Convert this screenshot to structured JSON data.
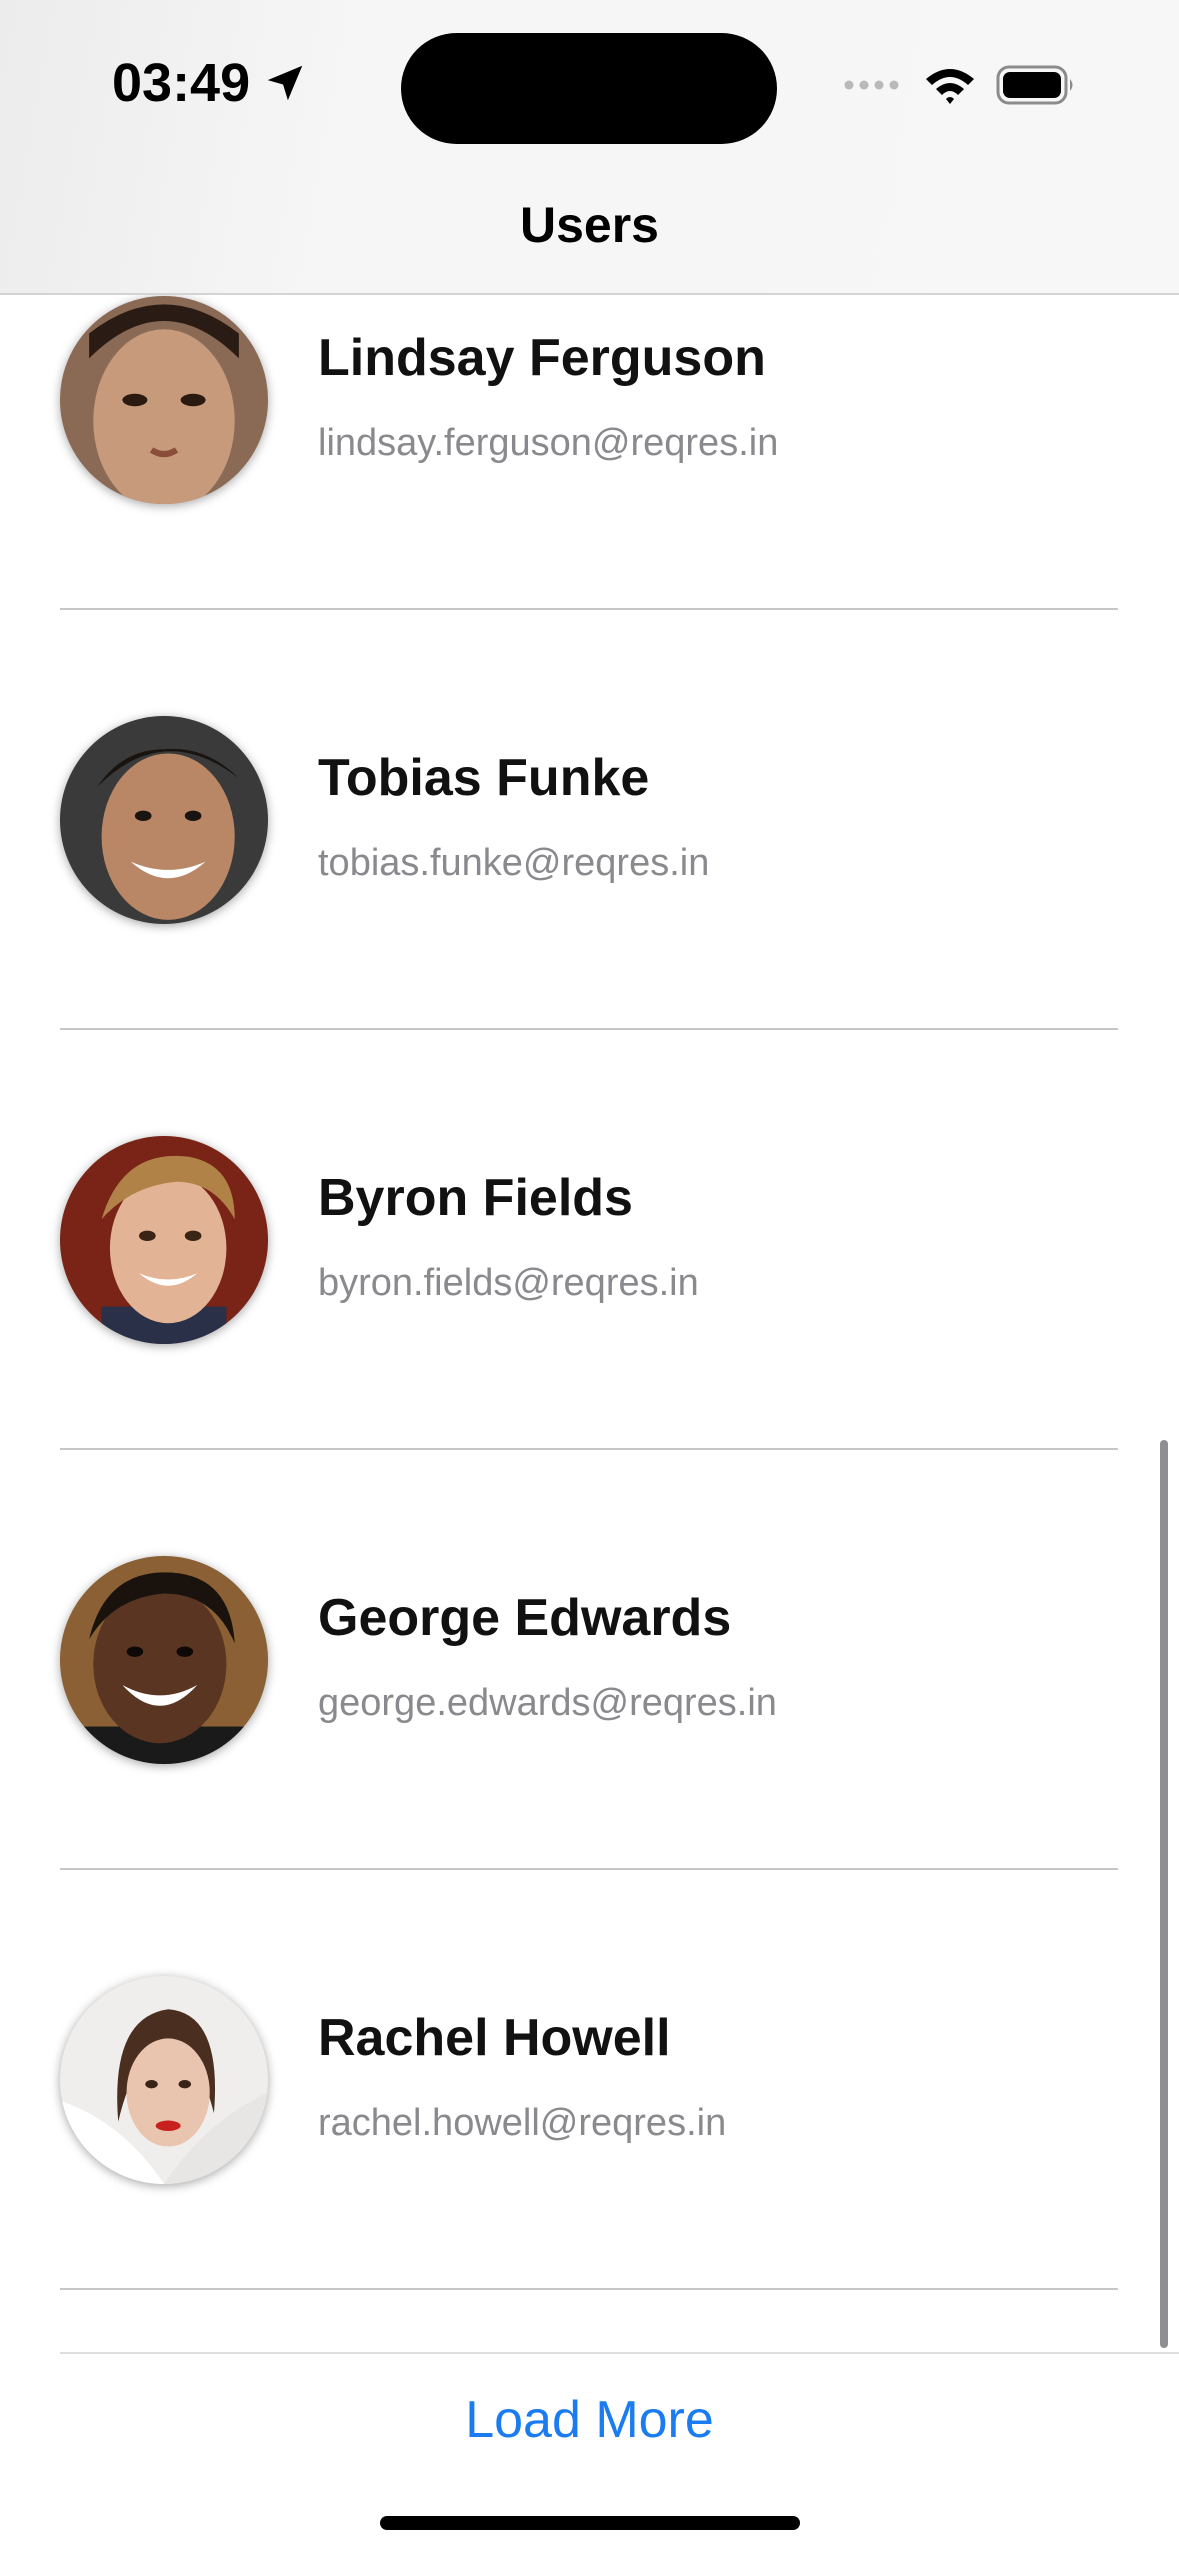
{
  "status_bar": {
    "time": "03:49",
    "icons": [
      "location-arrow-icon",
      "cellular-signal-icon",
      "wifi-icon",
      "battery-icon"
    ]
  },
  "nav": {
    "title": "Users"
  },
  "users": [
    {
      "name": "Lindsay Ferguson",
      "email": "lindsay.ferguson@reqres.in"
    },
    {
      "name": "Tobias Funke",
      "email": "tobias.funke@reqres.in"
    },
    {
      "name": "Byron Fields",
      "email": "byron.fields@reqres.in"
    },
    {
      "name": "George Edwards",
      "email": "george.edwards@reqres.in"
    },
    {
      "name": "Rachel Howell",
      "email": "rachel.howell@reqres.in"
    }
  ],
  "footer": {
    "load_more_label": "Load More"
  },
  "colors": {
    "accent": "#1a7cf0",
    "secondary_text": "#8a8a8e",
    "separator": "#c6c6c8"
  }
}
